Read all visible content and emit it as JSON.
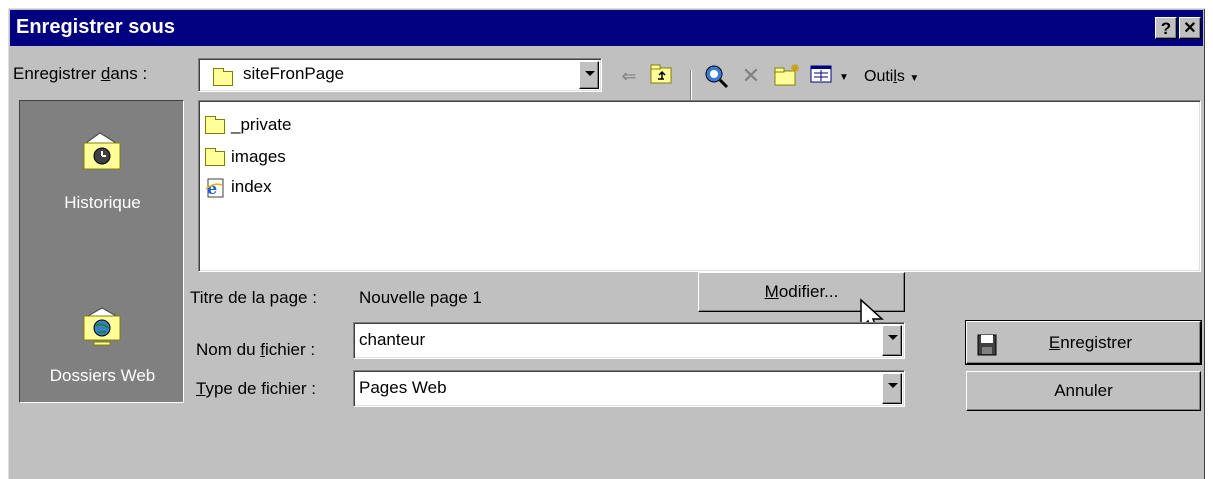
{
  "window": {
    "title": "Enregistrer sous",
    "help_label": "?",
    "close_label": "✕"
  },
  "save_in": {
    "label_pre": "Enregistrer ",
    "label_accel": "d",
    "label_post": "ans :",
    "value": "siteFronPage"
  },
  "toolbar": {
    "tools_label_pre": "Outi",
    "tools_label_accel": "l",
    "tools_label_post": "s"
  },
  "places": [
    {
      "label": "Historique",
      "icon": "history-folder-icon"
    },
    {
      "label": "Dossiers Web",
      "icon": "web-folders-icon"
    }
  ],
  "files": [
    {
      "name": "_private",
      "icon": "folder-icon"
    },
    {
      "name": "images",
      "icon": "folder-icon"
    },
    {
      "name": "index",
      "icon": "ie-page-icon"
    }
  ],
  "page_title": {
    "label": "Titre de la page :",
    "value": "Nouvelle page 1",
    "modify_pre": "",
    "modify_accel": "M",
    "modify_post": "odifier..."
  },
  "filename": {
    "label_pre": "Nom du ",
    "label_accel": "f",
    "label_post": "ichier :",
    "value": "chanteur"
  },
  "filetype": {
    "label_pre": "",
    "label_accel": "T",
    "label_post": "ype de fichier :",
    "value": "Pages Web"
  },
  "buttons": {
    "save_pre": "",
    "save_accel": "E",
    "save_post": "nregistrer",
    "cancel": "Annuler"
  },
  "colors": {
    "titlebar": "#000080",
    "dialog_face": "#c0c0c0",
    "places_bar": "#808080",
    "folder_yellow": "#ffff99"
  }
}
